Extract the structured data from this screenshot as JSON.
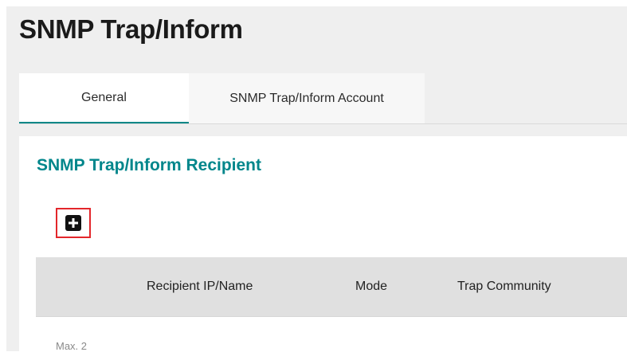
{
  "page": {
    "title": "SNMP Trap/Inform"
  },
  "tabs": [
    {
      "label": "General",
      "active": true
    },
    {
      "label": "SNMP Trap/Inform Account",
      "active": false
    }
  ],
  "section": {
    "title": "SNMP Trap/Inform Recipient",
    "add_button_icon": "plus-square-icon"
  },
  "table": {
    "columns": [
      "Recipient IP/Name",
      "Mode",
      "Trap Community"
    ],
    "rows": []
  },
  "footer": {
    "max_note": "Max. 2"
  },
  "colors": {
    "accent": "#008787",
    "highlight_border": "#e3262b",
    "header_bg": "#e0e0e0",
    "page_bg": "#efefef"
  }
}
